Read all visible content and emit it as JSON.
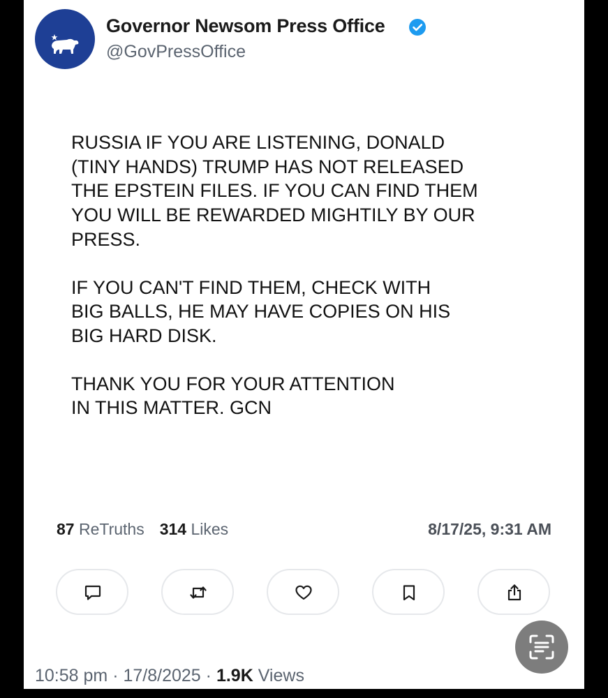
{
  "account": {
    "display_name": "Governor Newsom Press Office",
    "handle": "@GovPressOffice",
    "verified_icon": "verified-badge-icon",
    "avatar_icon": "california-bear-icon",
    "avatar_color": "#1e3f95"
  },
  "post": {
    "paragraphs": [
      "RUSSIA IF YOU ARE LISTENING, DONALD\n(TINY HANDS) TRUMP HAS NOT RELEASED\nTHE EPSTEIN FILES.  IF YOU CAN FIND THEM\nYOU WILL BE REWARDED MIGHTILY BY OUR\nPRESS.",
      "IF YOU CAN'T FIND THEM, CHECK WITH\nBIG BALLS, HE MAY HAVE COPIES ON HIS\nBIG HARD DISK.",
      "THANK YOU FOR YOUR ATTENTION\nIN THIS MATTER. GCN"
    ]
  },
  "stats": {
    "retruths_count": "87",
    "retruths_label": "ReTruths",
    "likes_count": "314",
    "likes_label": "Likes",
    "date": "8/17/25, 9:31 AM"
  },
  "actions": [
    {
      "name": "reply",
      "icon": "comment-icon"
    },
    {
      "name": "retruth",
      "icon": "repost-icon"
    },
    {
      "name": "like",
      "icon": "heart-icon"
    },
    {
      "name": "bookmark",
      "icon": "bookmark-icon"
    },
    {
      "name": "share",
      "icon": "share-icon"
    }
  ],
  "overlay": {
    "scan_icon": "text-scan-icon"
  },
  "meta": {
    "time": "10:58 pm",
    "separator": "·",
    "date": "17/8/2025",
    "views_count": "1.9K",
    "views_label": "Views"
  }
}
